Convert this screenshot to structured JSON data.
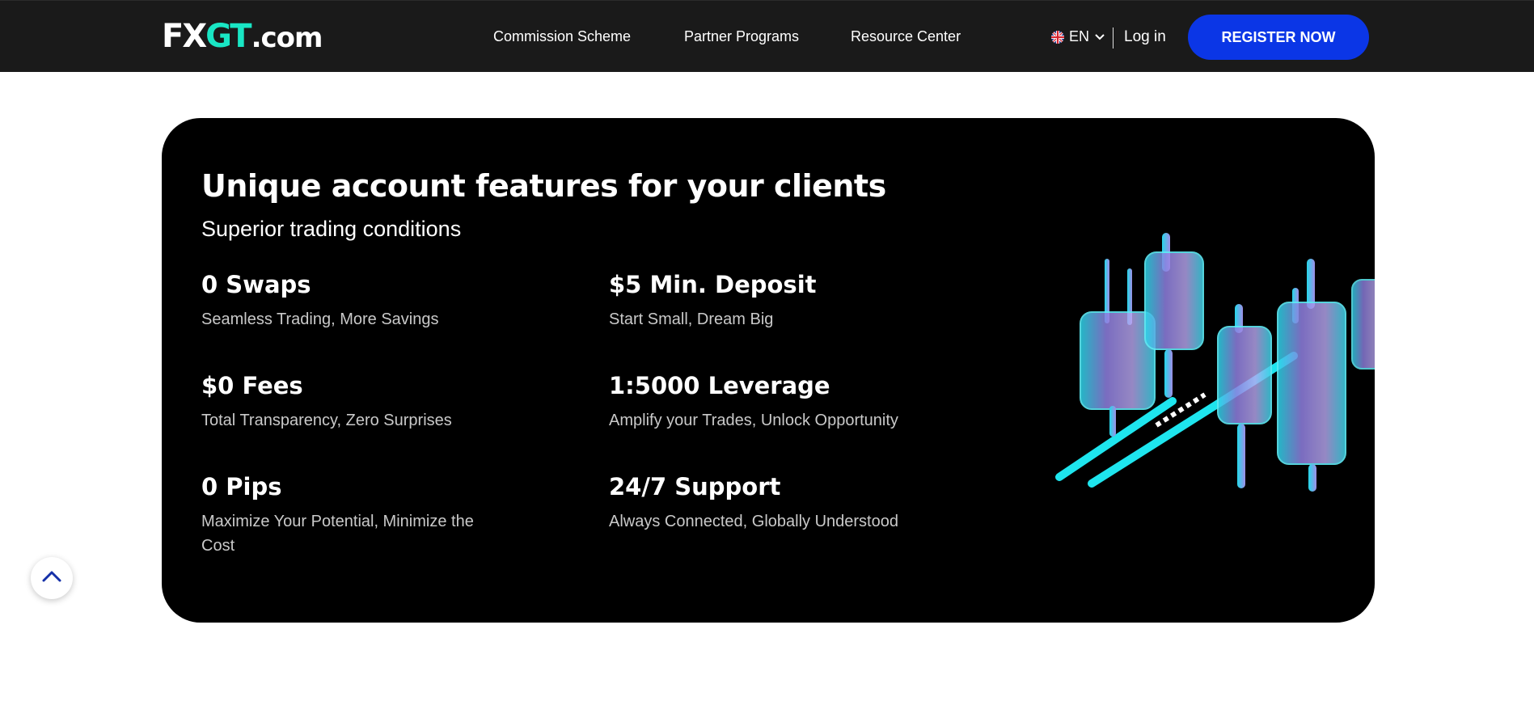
{
  "header": {
    "logo": {
      "fx": "FX",
      "gt": "GT",
      "tld": ".com"
    },
    "nav": [
      {
        "label": "Commission Scheme"
      },
      {
        "label": "Partner Programs"
      },
      {
        "label": "Resource Center"
      }
    ],
    "language": {
      "code": "EN",
      "flag_icon": "uk-flag-icon",
      "chevron_icon": "chevron-down-icon"
    },
    "login_label": "Log in",
    "register_label": "REGISTER NOW",
    "colors": {
      "header_bg": "#1a1a1a",
      "register_bg": "#0b36e6",
      "logo_accent": "#19e6c4"
    }
  },
  "features_section": {
    "title": "Unique account features for your clients",
    "subtitle": "Superior trading conditions",
    "features": [
      {
        "title": "0 Swaps",
        "description": "Seamless Trading, More Savings"
      },
      {
        "title": "$5 Min. Deposit",
        "description": "Start Small, Dream Big"
      },
      {
        "title": "$0 Fees",
        "description": "Total Transparency, Zero Surprises"
      },
      {
        "title": "1:5000 Leverage",
        "description": "Amplify your Trades, Unlock Opportunity"
      },
      {
        "title": "0 Pips",
        "description": "Maximize Your Potential, Minimize the Cost"
      },
      {
        "title": "24/7 Support",
        "description": "Always Connected, Globally Understood"
      }
    ],
    "illustration_icon": "candlestick-chart-illustration",
    "colors": {
      "card_bg": "#000000",
      "candle_cyan": "#20e8f0",
      "candle_purple": "#9a86e6"
    }
  },
  "scroll_top": {
    "icon": "chevron-up-icon"
  }
}
